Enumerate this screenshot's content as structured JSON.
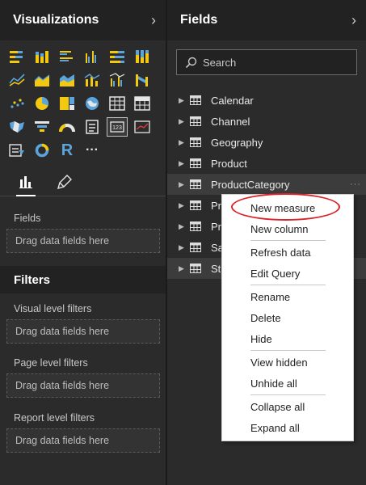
{
  "visualizations": {
    "title": "Visualizations",
    "icons": [
      "stacked-bar-chart-icon",
      "stacked-column-chart-icon",
      "clustered-bar-chart-icon",
      "clustered-column-chart-icon",
      "100-stacked-bar-chart-icon",
      "100-stacked-column-chart-icon",
      "line-chart-icon",
      "area-chart-icon",
      "stacked-area-chart-icon",
      "line-and-stacked-column-icon",
      "line-and-clustered-column-icon",
      "ribbon-chart-icon",
      "scatter-chart-icon",
      "pie-chart-icon",
      "treemap-icon",
      "map-icon",
      "table-icon",
      "matrix-icon",
      "filled-map-icon",
      "funnel-icon",
      "gauge-icon",
      "multi-row-card-icon",
      "card-icon",
      "kpi-icon",
      "slicer-icon",
      "donut-chart-icon",
      "r-script-visual-icon",
      "more-visuals-icon"
    ],
    "r_label": "R",
    "more_label": "···",
    "fields_label": "Fields",
    "drag_here": "Drag data fields here"
  },
  "filters": {
    "title": "Filters",
    "visual_level": "Visual level filters",
    "page_level": "Page level filters",
    "report_level": "Report level filters",
    "drag_here": "Drag data fields here"
  },
  "fields": {
    "title": "Fields",
    "search_placeholder": "Search",
    "tables": [
      "Calendar",
      "Channel",
      "Geography",
      "Product",
      "ProductCategory",
      "Pr",
      "Pr",
      "Sa",
      "St"
    ]
  },
  "context_menu": {
    "items": [
      "New measure",
      "New column",
      "Refresh data",
      "Edit Query",
      "Rename",
      "Delete",
      "Hide",
      "View hidden",
      "Unhide all",
      "Collapse all",
      "Expand all"
    ]
  },
  "colors": {
    "pane_bg": "#2b2b2b",
    "accent_yellow": "#f2c811",
    "accent_blue": "#5ba4dc",
    "highlight_red": "#d9262b"
  }
}
